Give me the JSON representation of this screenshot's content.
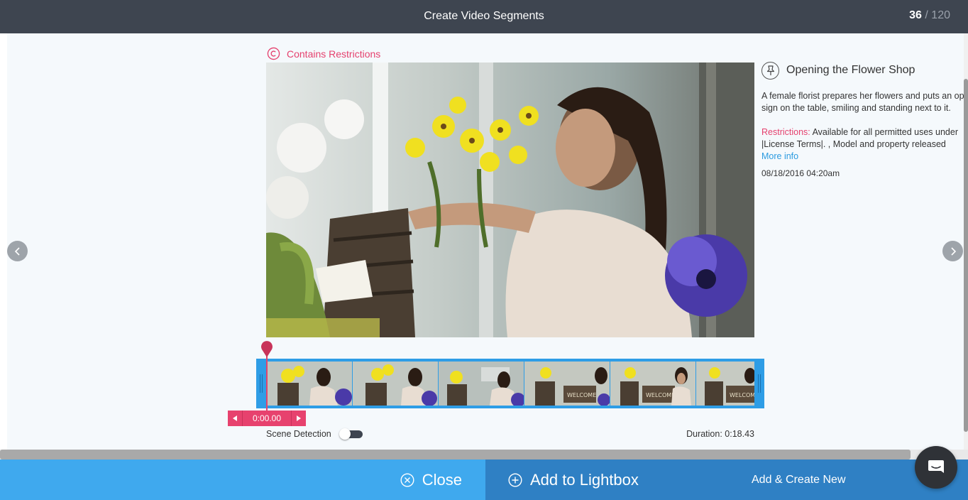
{
  "header": {
    "title": "Create Video Segments",
    "counter_current": "36",
    "counter_sep": " / ",
    "counter_total": "120"
  },
  "asset": {
    "restriction_flag": "Contains Restrictions",
    "title": "Opening the Flower Shop",
    "description": "A female florist prepares her flowers and puts an open sign on the table, smiling and standing next to it.",
    "restrictions_label": "Restrictions:",
    "restrictions_text_1": " Available for all permitted uses under",
    "restrictions_text_2": "|License Terms|. , Model and property released",
    "more_info": "More info",
    "date": "08/18/2016 04:20am"
  },
  "player": {
    "time": "0:00.00",
    "scene_detection_label": "Scene Detection",
    "scene_detection_on": false,
    "duration": "Duration: 0:18.43"
  },
  "footer": {
    "close_label": "Close",
    "lightbox_label": "Add to Lightbox",
    "create_new_label": "Add & Create New"
  },
  "colors": {
    "header_bg": "#3e4550",
    "accent_pink": "#e5416e",
    "timeline_blue": "#2e9de6",
    "close_blue": "#3fa9ee",
    "action_blue": "#2f80c4",
    "link_blue": "#2b9be0"
  },
  "icons": {
    "restriction": "copyright-icon",
    "pin": "pin-icon",
    "prev": "chevron-left-icon",
    "next": "chevron-right-icon",
    "close": "close-circle-icon",
    "lightbox": "plus-circle-icon",
    "chat": "chat-icon"
  }
}
